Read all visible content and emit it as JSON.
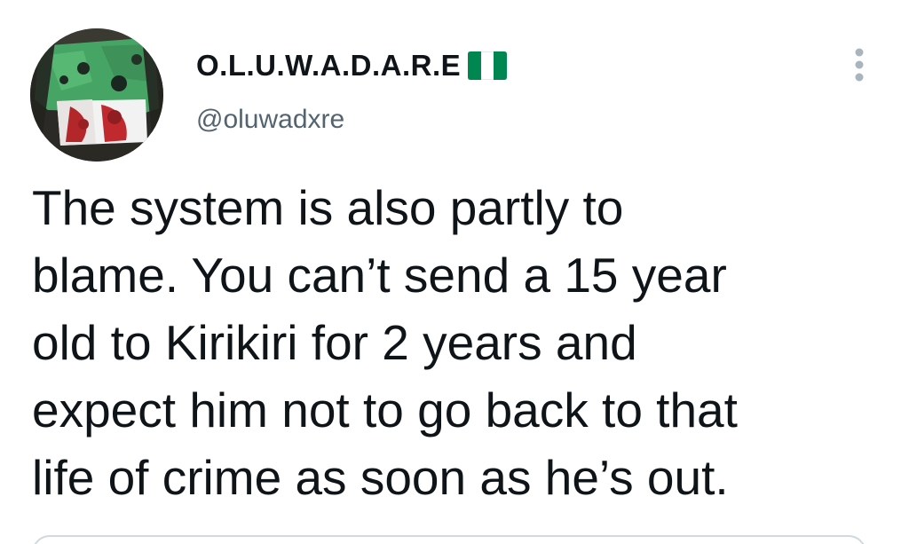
{
  "tweet": {
    "author": {
      "display_name": "O.L.U.W.A.D.A.R.E",
      "flag_icon": "nigeria-flag-emoji",
      "handle": "@oluwadxre",
      "avatar_icon": "profile-photo"
    },
    "more_icon": "vertical-ellipsis-icon",
    "text_lines": [
      "The system is also partly to",
      "blame. You can’t send a 15 year",
      "old to Kirikiri for 2 years and",
      "expect him not to go back to that",
      "life of crime as soon as he’s out."
    ]
  },
  "colors": {
    "text_primary": "#0f1419",
    "text_secondary": "#536471",
    "flag_green": "#008751",
    "border": "#cfd9de"
  }
}
